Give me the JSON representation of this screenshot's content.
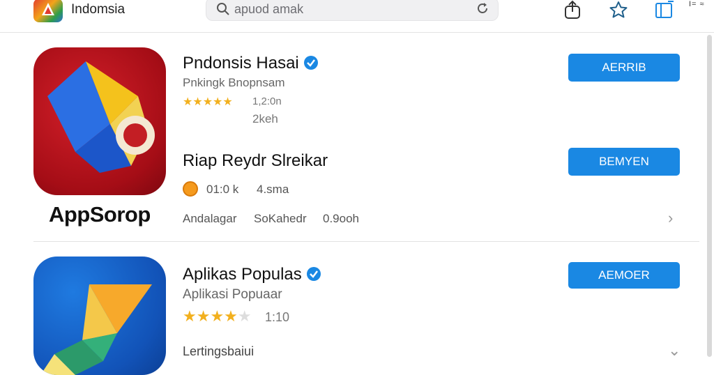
{
  "header": {
    "brand": "Indomsia",
    "search_text": "apuod amak",
    "corner_text": "I= ≈"
  },
  "app1": {
    "title": "Pndonsis Hasai",
    "subtitle": "Pnkingk Bnopnsam",
    "rating_text": "1,2:0n",
    "size_text": "2keh",
    "button_label": "AERRIB"
  },
  "app1_second": {
    "title": "Riap Reydr Slreikar",
    "stat_text": "01:0 k",
    "stat_extra": "4.sma",
    "button_label": "BEMYEN"
  },
  "app_label": "AppSorop",
  "meta": {
    "item1": "Andalagar",
    "item2": "SoKahedr",
    "item3": "0.9ooh"
  },
  "app2": {
    "title": "Aplikas Populas",
    "subtitle": "Aplikasi Popuaar",
    "rating_text": "1:10",
    "button_label": "AEMOER",
    "bottom_text": "Lertingsbaiui"
  }
}
